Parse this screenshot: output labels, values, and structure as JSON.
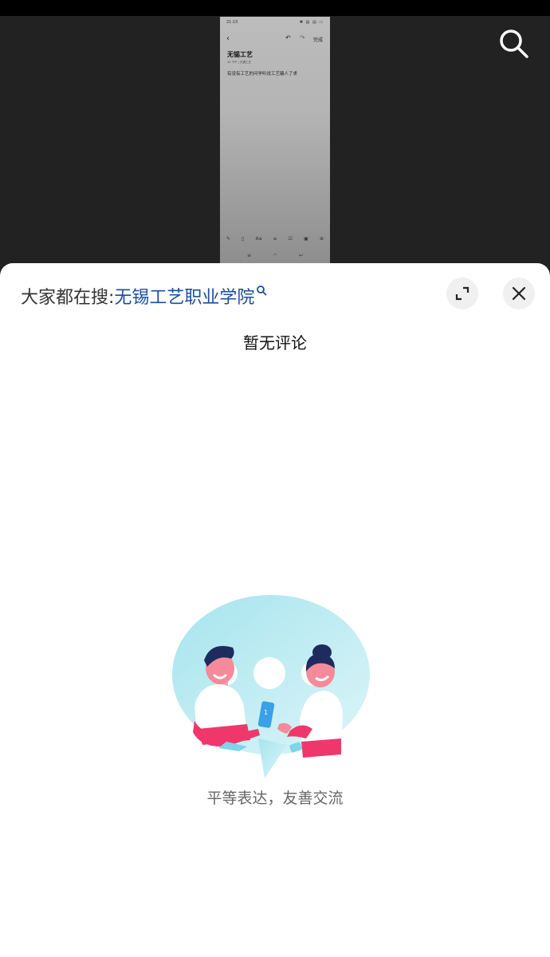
{
  "phone_screenshot": {
    "time": "21:15",
    "status_icons": "✱ ▤ ▤ ▭",
    "done_label": "完成",
    "note_title": "无锡工艺",
    "note_meta": "14 下午 | 无锡工艺",
    "note_body": "有没有工艺的问学听说工艺骗人了求",
    "toolbar_icons": [
      "pen-icon",
      "pause-icon",
      "text-format-icon",
      "list-icon",
      "checkbox-icon",
      "image-icon",
      "add-icon"
    ],
    "toolbar_glyphs": [
      "✎",
      "▯",
      "Aa",
      "≡",
      "☑",
      "▣",
      "⊕"
    ],
    "nav_glyphs": [
      "≡",
      "◠",
      "↩"
    ]
  },
  "sheet": {
    "trending_label": "大家都在搜:",
    "trending_keyword": "无锡工艺职业学院",
    "empty_title": "暂无评论",
    "empty_caption": "平等表达，友善交流"
  },
  "colors": {
    "keyword": "#1a4d9c",
    "illustration_bubble": "#b8e9f1",
    "illustration_shirt_accent": "#f0376b",
    "illustration_hair": "#1e2b5e"
  },
  "icons": {
    "search": "search-icon",
    "expand": "expand-icon",
    "close": "close-icon",
    "trend_search": "search-icon"
  }
}
